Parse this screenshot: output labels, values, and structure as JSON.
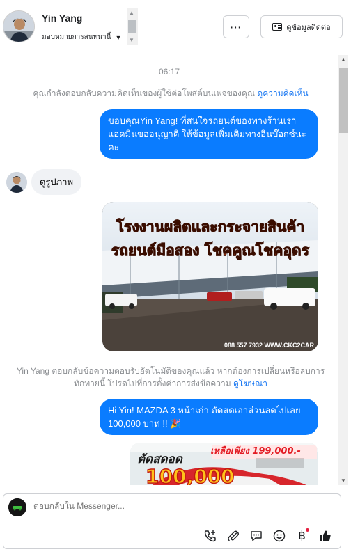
{
  "header": {
    "contact_name": "Yin Yang",
    "assignment_label": "มอบหมายการสนทนานี้",
    "more_button_label": "···",
    "contact_info_button_label": "ดูข้อมูลติดต่อ"
  },
  "conversation": {
    "timestamp": "06:17",
    "notice_reply_comment": "คุณกำลังตอบกลับความคิดเห็นของผู้ใช้ต่อโพสต์บนเพจของคุณ",
    "notice_reply_comment_link": "ดูความคิดเห็น",
    "messages": [
      {
        "direction": "outgoing",
        "text": "ขอบคุณYin Yang! ที่สนใจรถยนต์ของทางร้านเรา แอดมินขออนุญาติ ให้ข้อมูลเพิ่มเติมทางอินบ๊อกซ์นะคะ"
      },
      {
        "direction": "incoming",
        "text": "ดูรูปภาพ"
      },
      {
        "direction": "outgoing",
        "type": "image",
        "image_title_line1": "โรงงานผลิตและกระจายสินค้า",
        "image_title_line2": "รถยนต์มือสอง โชคคูณโชคอุดร",
        "image_phone": "088 557 7932 WWW.CKC2CAR"
      },
      {
        "direction": "system",
        "text": "Yin Yang ตอบกลับข้อความตอบรับอัตโนมัติของคุณแล้ว หากต้องการเปลี่ยนหรือลบการทักทายนี้ โปรดไปที่การตั้งค่าการส่งข้อความ",
        "link": "ดูโฆษณา"
      },
      {
        "direction": "outgoing",
        "text": "Hi Yin! MAZDA 3 หน้าเก่า ตัดสดเอาส่วนลดไปเลย 100,000 บาท !! 🎉"
      },
      {
        "direction": "outgoing",
        "type": "image",
        "promo_headline": "ตัดสดอด",
        "promo_price": "เหลือเพียง 199,000.-",
        "promo_discount": "100,000"
      }
    ]
  },
  "composer": {
    "placeholder": "ตอบกลับใน Messenger..."
  },
  "colors": {
    "outgoing_bubble": "#0a7cff",
    "incoming_bubble": "#f0f2f5",
    "link": "#1877f2",
    "meta_text": "#8a8d91"
  },
  "icons": {
    "tools": [
      "call-add-icon",
      "attach-icon",
      "chat-bubble-icon",
      "emoji-icon",
      "baht-icon",
      "thumbs-up-icon"
    ]
  }
}
